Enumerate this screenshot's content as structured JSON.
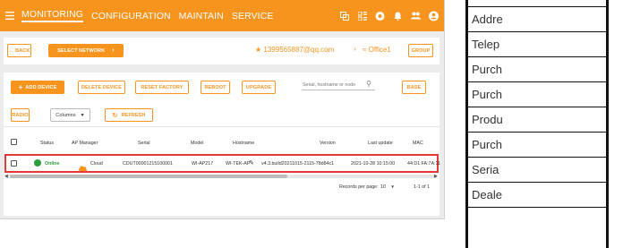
{
  "nav": {
    "menu_icon": "menu-icon",
    "items": [
      "MONITORING",
      "CONFIGURATION",
      "MAINTAIN",
      "SERVICE"
    ],
    "icons": [
      "network-icon",
      "grid-icon",
      "wifi-icon",
      "bell-icon",
      "users-icon",
      "account-icon"
    ]
  },
  "toolbar": {
    "back": "BACK",
    "select_network": "SELECT NETWORK",
    "account": "1399565887@qq.com",
    "network": "Office1",
    "group": "GROUP"
  },
  "actions": {
    "add_device": "ADD DEVICE",
    "delete_device": "DELETE DEVICE",
    "reset_factory": "RESET FACTORY",
    "reboot": "REBOOT",
    "upgrade": "UPGRADE",
    "search_placeholder": "Serial, hostname or node",
    "base": "BASE",
    "radio": "RADIO",
    "columns": "Columns",
    "refresh": "REFRESH"
  },
  "table": {
    "headers": [
      "Status",
      "AP Manager",
      "Serial",
      "Model",
      "Hostname",
      "Version",
      "Last update",
      "MAC"
    ],
    "rows": [
      {
        "status": "Online",
        "ap_manager": "Cloud",
        "serial": "CDUT00001215100001",
        "model": "WI-AP217",
        "hostname": "WI-TEK-AP",
        "version": "v4.3.build20211015-2115-78d84c1",
        "last_update": "2021-10-28 10:15:00",
        "mac": "44:D1:FA:7A:11"
      }
    ]
  },
  "pagination": {
    "records_label": "Records per page:",
    "per_page": "10",
    "range": "1-1 of 1"
  },
  "side_panel": {
    "rows": [
      "Addre",
      "Telep",
      "Purch",
      "Purch",
      "Produ",
      "Purch",
      "Seria",
      "Deale"
    ]
  },
  "colors": {
    "accent": "#f7941d",
    "online": "#2e9b3b"
  }
}
